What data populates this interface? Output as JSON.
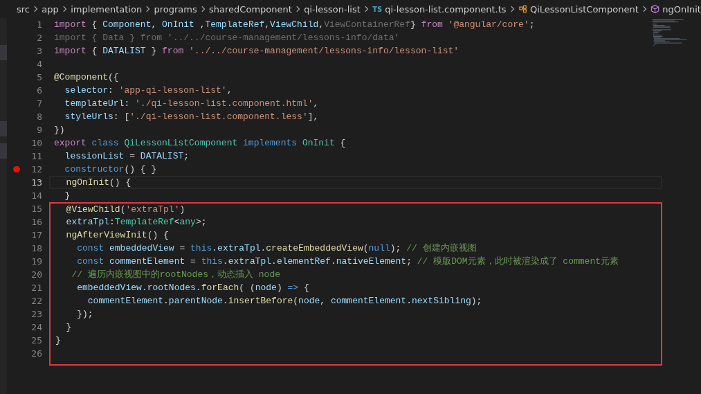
{
  "breadcrumb": [
    {
      "kind": "folder",
      "label": "src"
    },
    {
      "kind": "folder",
      "label": "app"
    },
    {
      "kind": "folder",
      "label": "implementation"
    },
    {
      "kind": "folder",
      "label": "programs"
    },
    {
      "kind": "folder",
      "label": "sharedComponent"
    },
    {
      "kind": "folder",
      "label": "qi-lesson-list"
    },
    {
      "kind": "file",
      "badge": "TS",
      "label": "qi-lesson-list.component.ts"
    },
    {
      "kind": "class",
      "label": "QiLessonListComponent"
    },
    {
      "kind": "method",
      "label": "ngOnInit"
    }
  ],
  "lines": [
    {
      "number": "1",
      "breakpoint": false,
      "current": false,
      "boxed": false,
      "tokens": [
        {
          "kind": "keyword",
          "text": "import"
        },
        {
          "kind": "punct",
          "text": " { "
        },
        {
          "kind": "var",
          "text": "Component"
        },
        {
          "kind": "punct",
          "text": ", "
        },
        {
          "kind": "var",
          "text": "OnInit"
        },
        {
          "kind": "punct",
          "text": " ,"
        },
        {
          "kind": "var",
          "text": "TemplateRef"
        },
        {
          "kind": "punct",
          "text": ","
        },
        {
          "kind": "var",
          "text": "ViewChild"
        },
        {
          "kind": "punct",
          "text": ","
        },
        {
          "kind": "faded",
          "text": "ViewContainerRef"
        },
        {
          "kind": "punct",
          "text": "} "
        },
        {
          "kind": "keyword",
          "text": "from"
        },
        {
          "kind": "string",
          "text": " '@angular/core'"
        },
        {
          "kind": "punct",
          "text": ";"
        }
      ]
    },
    {
      "number": "2",
      "breakpoint": false,
      "current": false,
      "boxed": false,
      "tokens": [
        {
          "kind": "faded",
          "text": "import { Data } from '../../course-management/lessons-info/data'"
        }
      ]
    },
    {
      "number": "3",
      "breakpoint": false,
      "current": false,
      "boxed": false,
      "tokens": [
        {
          "kind": "keyword",
          "text": "import"
        },
        {
          "kind": "punct",
          "text": " { "
        },
        {
          "kind": "var",
          "text": "DATALIST"
        },
        {
          "kind": "punct",
          "text": " } "
        },
        {
          "kind": "keyword",
          "text": "from"
        },
        {
          "kind": "string",
          "text": " '../../course-management/lessons-info/lesson-list'"
        }
      ]
    },
    {
      "number": "4",
      "breakpoint": false,
      "current": false,
      "boxed": false
    },
    {
      "number": "5",
      "breakpoint": false,
      "current": false,
      "boxed": false,
      "tokens": [
        {
          "kind": "func",
          "text": "@Component"
        },
        {
          "kind": "punct",
          "text": "({"
        }
      ]
    },
    {
      "number": "6",
      "breakpoint": false,
      "current": false,
      "boxed": false,
      "tokens": [
        {
          "kind": "var",
          "text": "  selector"
        },
        {
          "kind": "punct",
          "text": ": "
        },
        {
          "kind": "string",
          "text": "'app-qi-lesson-list'"
        },
        {
          "kind": "punct",
          "text": ","
        }
      ]
    },
    {
      "number": "7",
      "breakpoint": false,
      "current": false,
      "boxed": false,
      "tokens": [
        {
          "kind": "var",
          "text": "  templateUrl"
        },
        {
          "kind": "punct",
          "text": ": "
        },
        {
          "kind": "string",
          "text": "'./qi-lesson-list.component.html'"
        },
        {
          "kind": "punct",
          "text": ","
        }
      ]
    },
    {
      "number": "8",
      "breakpoint": false,
      "current": false,
      "boxed": false,
      "tokens": [
        {
          "kind": "var",
          "text": "  styleUrls"
        },
        {
          "kind": "punct",
          "text": ": ["
        },
        {
          "kind": "string",
          "text": "'./qi-lesson-list.component.less'"
        },
        {
          "kind": "punct",
          "text": "],"
        }
      ]
    },
    {
      "number": "9",
      "breakpoint": false,
      "current": false,
      "boxed": false,
      "tokens": [
        {
          "kind": "punct",
          "text": "})"
        }
      ]
    },
    {
      "number": "10",
      "breakpoint": false,
      "current": false,
      "boxed": false,
      "tokens": [
        {
          "kind": "keyword",
          "text": "export"
        },
        {
          "kind": "storage",
          "text": " class "
        },
        {
          "kind": "type",
          "text": "QiLessonListComponent"
        },
        {
          "kind": "storage",
          "text": " implements "
        },
        {
          "kind": "type",
          "text": "OnInit"
        },
        {
          "kind": "punct",
          "text": " {"
        }
      ]
    },
    {
      "number": "11",
      "breakpoint": false,
      "current": false,
      "boxed": false,
      "tokens": [
        {
          "kind": "var",
          "text": "  lessionList"
        },
        {
          "kind": "punct",
          "text": " = "
        },
        {
          "kind": "var",
          "text": "DATALIST"
        },
        {
          "kind": "punct",
          "text": ";"
        }
      ]
    },
    {
      "number": "12",
      "breakpoint": true,
      "current": false,
      "boxed": false,
      "tokens": [
        {
          "kind": "storage",
          "text": "  constructor"
        },
        {
          "kind": "punct",
          "text": "() { }"
        }
      ]
    },
    {
      "number": "13",
      "breakpoint": false,
      "current": true,
      "boxed": false,
      "tokens": [
        {
          "kind": "func",
          "text": "  ngOnInit"
        },
        {
          "kind": "punct",
          "text": "() {"
        }
      ]
    },
    {
      "number": "14",
      "breakpoint": false,
      "current": false,
      "boxed": false,
      "tokens": [
        {
          "kind": "punct",
          "text": "  }"
        }
      ]
    },
    {
      "number": "15",
      "breakpoint": false,
      "current": false,
      "boxed": true,
      "tokens": [
        {
          "kind": "func",
          "text": "  @ViewChild"
        },
        {
          "kind": "punct",
          "text": "("
        },
        {
          "kind": "string",
          "text": "'extraTpl'"
        },
        {
          "kind": "punct",
          "text": ")"
        }
      ]
    },
    {
      "number": "16",
      "breakpoint": false,
      "current": false,
      "boxed": true,
      "tokens": [
        {
          "kind": "var",
          "text": "  extraTpl"
        },
        {
          "kind": "punct",
          "text": ":"
        },
        {
          "kind": "type",
          "text": "TemplateRef"
        },
        {
          "kind": "punct",
          "text": "<"
        },
        {
          "kind": "type",
          "text": "any"
        },
        {
          "kind": "punct",
          "text": ">;"
        }
      ]
    },
    {
      "number": "17",
      "breakpoint": false,
      "current": false,
      "boxed": true,
      "tokens": [
        {
          "kind": "func",
          "text": "  ngAfterViewInit"
        },
        {
          "kind": "punct",
          "text": "() {"
        }
      ]
    },
    {
      "number": "18",
      "breakpoint": false,
      "current": false,
      "boxed": true,
      "tokens": [
        {
          "kind": "storage",
          "text": "    const "
        },
        {
          "kind": "var",
          "text": "embeddedView"
        },
        {
          "kind": "punct",
          "text": " = "
        },
        {
          "kind": "storage",
          "text": "this"
        },
        {
          "kind": "punct",
          "text": "."
        },
        {
          "kind": "var",
          "text": "extraTpl"
        },
        {
          "kind": "punct",
          "text": "."
        },
        {
          "kind": "func",
          "text": "createEmbeddedView"
        },
        {
          "kind": "punct",
          "text": "("
        },
        {
          "kind": "storage",
          "text": "null"
        },
        {
          "kind": "punct",
          "text": "); "
        },
        {
          "kind": "comment",
          "text": "// 创建内嵌视图"
        }
      ]
    },
    {
      "number": "19",
      "breakpoint": false,
      "current": false,
      "boxed": true,
      "tokens": [
        {
          "kind": "storage",
          "text": "    const "
        },
        {
          "kind": "var",
          "text": "commentElement"
        },
        {
          "kind": "punct",
          "text": " = "
        },
        {
          "kind": "storage",
          "text": "this"
        },
        {
          "kind": "punct",
          "text": "."
        },
        {
          "kind": "var",
          "text": "extraTpl"
        },
        {
          "kind": "punct",
          "text": "."
        },
        {
          "kind": "var",
          "text": "elementRef"
        },
        {
          "kind": "punct",
          "text": "."
        },
        {
          "kind": "var",
          "text": "nativeElement"
        },
        {
          "kind": "punct",
          "text": "; "
        },
        {
          "kind": "comment",
          "text": "// 模版DOM元素，此时被渲染成了 comment元素"
        }
      ]
    },
    {
      "number": "20",
      "breakpoint": false,
      "current": false,
      "boxed": true,
      "tokens": [
        {
          "kind": "comment",
          "text": "   // 遍历内嵌视图中的rootNodes，动态插入 node"
        }
      ]
    },
    {
      "number": "21",
      "breakpoint": false,
      "current": false,
      "boxed": true,
      "tokens": [
        {
          "kind": "var",
          "text": "    embeddedView"
        },
        {
          "kind": "punct",
          "text": "."
        },
        {
          "kind": "var",
          "text": "rootNodes"
        },
        {
          "kind": "punct",
          "text": "."
        },
        {
          "kind": "func",
          "text": "forEach"
        },
        {
          "kind": "punct",
          "text": "( ("
        },
        {
          "kind": "var",
          "text": "node"
        },
        {
          "kind": "punct",
          "text": ") "
        },
        {
          "kind": "storage",
          "text": "=>"
        },
        {
          "kind": "punct",
          "text": " {"
        }
      ]
    },
    {
      "number": "22",
      "breakpoint": false,
      "current": false,
      "boxed": true,
      "tokens": [
        {
          "kind": "var",
          "text": "      commentElement"
        },
        {
          "kind": "punct",
          "text": "."
        },
        {
          "kind": "var",
          "text": "parentNode"
        },
        {
          "kind": "punct",
          "text": "."
        },
        {
          "kind": "func",
          "text": "insertBefore"
        },
        {
          "kind": "punct",
          "text": "("
        },
        {
          "kind": "var",
          "text": "node"
        },
        {
          "kind": "punct",
          "text": ", "
        },
        {
          "kind": "var",
          "text": "commentElement"
        },
        {
          "kind": "punct",
          "text": "."
        },
        {
          "kind": "var",
          "text": "nextSibling"
        },
        {
          "kind": "punct",
          "text": ");"
        }
      ]
    },
    {
      "number": "23",
      "breakpoint": false,
      "current": false,
      "boxed": true,
      "tokens": [
        {
          "kind": "punct",
          "text": "    });"
        }
      ]
    },
    {
      "number": "24",
      "breakpoint": false,
      "current": false,
      "boxed": true,
      "tokens": [
        {
          "kind": "punct",
          "text": "  }"
        }
      ]
    },
    {
      "number": "25",
      "breakpoint": false,
      "current": false,
      "boxed": true,
      "tokens": [
        {
          "kind": "punct",
          "text": "}"
        }
      ]
    },
    {
      "number": "26",
      "breakpoint": false,
      "current": false,
      "boxed": true
    }
  ]
}
